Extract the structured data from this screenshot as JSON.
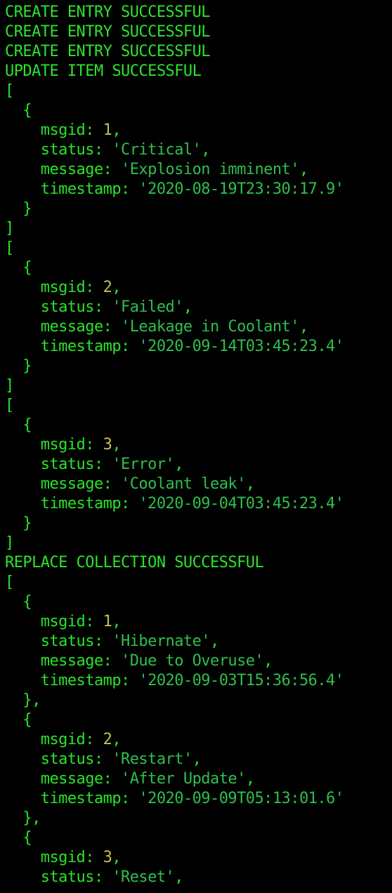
{
  "colors": {
    "background": "#000000",
    "status_text": "#2be42b",
    "key_text": "#28e428",
    "number_text": "#c4c04a",
    "string_text": "#2fbf4e"
  },
  "lines": [
    {
      "parts": [
        {
          "t": "CREATE ENTRY SUCCESSFUL",
          "c": "status"
        }
      ]
    },
    {
      "parts": [
        {
          "t": "CREATE ENTRY SUCCESSFUL",
          "c": "status"
        }
      ]
    },
    {
      "parts": [
        {
          "t": "CREATE ENTRY SUCCESSFUL",
          "c": "status"
        }
      ]
    },
    {
      "parts": [
        {
          "t": "UPDATE ITEM SUCCESSFUL",
          "c": "status"
        }
      ]
    },
    {
      "parts": [
        {
          "t": "[",
          "c": "punct"
        }
      ]
    },
    {
      "parts": [
        {
          "t": "  {",
          "c": "punct"
        }
      ]
    },
    {
      "parts": [
        {
          "t": "    msgid: ",
          "c": "key"
        },
        {
          "t": "1",
          "c": "num"
        },
        {
          "t": ",",
          "c": "punct"
        }
      ]
    },
    {
      "parts": [
        {
          "t": "    status: ",
          "c": "key"
        },
        {
          "t": "'Critical'",
          "c": "str"
        },
        {
          "t": ",",
          "c": "punct"
        }
      ]
    },
    {
      "parts": [
        {
          "t": "    message: ",
          "c": "key"
        },
        {
          "t": "'Explosion imminent'",
          "c": "str"
        },
        {
          "t": ",",
          "c": "punct"
        }
      ]
    },
    {
      "parts": [
        {
          "t": "    timestamp: ",
          "c": "key"
        },
        {
          "t": "'2020-08-19T23:30:17.9'",
          "c": "str"
        }
      ]
    },
    {
      "parts": [
        {
          "t": "  }",
          "c": "punct"
        }
      ]
    },
    {
      "parts": [
        {
          "t": "]",
          "c": "punct"
        }
      ]
    },
    {
      "parts": [
        {
          "t": "[",
          "c": "punct"
        }
      ]
    },
    {
      "parts": [
        {
          "t": "  {",
          "c": "punct"
        }
      ]
    },
    {
      "parts": [
        {
          "t": "    msgid: ",
          "c": "key"
        },
        {
          "t": "2",
          "c": "num"
        },
        {
          "t": ",",
          "c": "punct"
        }
      ]
    },
    {
      "parts": [
        {
          "t": "    status: ",
          "c": "key"
        },
        {
          "t": "'Failed'",
          "c": "str"
        },
        {
          "t": ",",
          "c": "punct"
        }
      ]
    },
    {
      "parts": [
        {
          "t": "    message: ",
          "c": "key"
        },
        {
          "t": "'Leakage in Coolant'",
          "c": "str"
        },
        {
          "t": ",",
          "c": "punct"
        }
      ]
    },
    {
      "parts": [
        {
          "t": "    timestamp: ",
          "c": "key"
        },
        {
          "t": "'2020-09-14T03:45:23.4'",
          "c": "str"
        }
      ]
    },
    {
      "parts": [
        {
          "t": "  }",
          "c": "punct"
        }
      ]
    },
    {
      "parts": [
        {
          "t": "]",
          "c": "punct"
        }
      ]
    },
    {
      "parts": [
        {
          "t": "[",
          "c": "punct"
        }
      ]
    },
    {
      "parts": [
        {
          "t": "  {",
          "c": "punct"
        }
      ]
    },
    {
      "parts": [
        {
          "t": "    msgid: ",
          "c": "key"
        },
        {
          "t": "3",
          "c": "num"
        },
        {
          "t": ",",
          "c": "punct"
        }
      ]
    },
    {
      "parts": [
        {
          "t": "    status: ",
          "c": "key"
        },
        {
          "t": "'Error'",
          "c": "str"
        },
        {
          "t": ",",
          "c": "punct"
        }
      ]
    },
    {
      "parts": [
        {
          "t": "    message: ",
          "c": "key"
        },
        {
          "t": "'Coolant leak'",
          "c": "str"
        },
        {
          "t": ",",
          "c": "punct"
        }
      ]
    },
    {
      "parts": [
        {
          "t": "    timestamp: ",
          "c": "key"
        },
        {
          "t": "'2020-09-04T03:45:23.4'",
          "c": "str"
        }
      ]
    },
    {
      "parts": [
        {
          "t": "  }",
          "c": "punct"
        }
      ]
    },
    {
      "parts": [
        {
          "t": "]",
          "c": "punct"
        }
      ]
    },
    {
      "parts": [
        {
          "t": "REPLACE COLLECTION SUCCESSFUL",
          "c": "status"
        }
      ]
    },
    {
      "parts": [
        {
          "t": "[",
          "c": "punct"
        }
      ]
    },
    {
      "parts": [
        {
          "t": "  {",
          "c": "punct"
        }
      ]
    },
    {
      "parts": [
        {
          "t": "    msgid: ",
          "c": "key"
        },
        {
          "t": "1",
          "c": "num"
        },
        {
          "t": ",",
          "c": "punct"
        }
      ]
    },
    {
      "parts": [
        {
          "t": "    status: ",
          "c": "key"
        },
        {
          "t": "'Hibernate'",
          "c": "str"
        },
        {
          "t": ",",
          "c": "punct"
        }
      ]
    },
    {
      "parts": [
        {
          "t": "    message: ",
          "c": "key"
        },
        {
          "t": "'Due to Overuse'",
          "c": "str"
        },
        {
          "t": ",",
          "c": "punct"
        }
      ]
    },
    {
      "parts": [
        {
          "t": "    timestamp: ",
          "c": "key"
        },
        {
          "t": "'2020-09-03T15:36:56.4'",
          "c": "str"
        }
      ]
    },
    {
      "parts": [
        {
          "t": "  },",
          "c": "punct"
        }
      ]
    },
    {
      "parts": [
        {
          "t": "  {",
          "c": "punct"
        }
      ]
    },
    {
      "parts": [
        {
          "t": "    msgid: ",
          "c": "key"
        },
        {
          "t": "2",
          "c": "num"
        },
        {
          "t": ",",
          "c": "punct"
        }
      ]
    },
    {
      "parts": [
        {
          "t": "    status: ",
          "c": "key"
        },
        {
          "t": "'Restart'",
          "c": "str"
        },
        {
          "t": ",",
          "c": "punct"
        }
      ]
    },
    {
      "parts": [
        {
          "t": "    message: ",
          "c": "key"
        },
        {
          "t": "'After Update'",
          "c": "str"
        },
        {
          "t": ",",
          "c": "punct"
        }
      ]
    },
    {
      "parts": [
        {
          "t": "    timestamp: ",
          "c": "key"
        },
        {
          "t": "'2020-09-09T05:13:01.6'",
          "c": "str"
        }
      ]
    },
    {
      "parts": [
        {
          "t": "  },",
          "c": "punct"
        }
      ]
    },
    {
      "parts": [
        {
          "t": "  {",
          "c": "punct"
        }
      ]
    },
    {
      "parts": [
        {
          "t": "    msgid: ",
          "c": "key"
        },
        {
          "t": "3",
          "c": "num"
        },
        {
          "t": ",",
          "c": "punct"
        }
      ]
    },
    {
      "parts": [
        {
          "t": "    status: ",
          "c": "key"
        },
        {
          "t": "'Reset'",
          "c": "str"
        },
        {
          "t": ",",
          "c": "punct"
        }
      ]
    }
  ]
}
